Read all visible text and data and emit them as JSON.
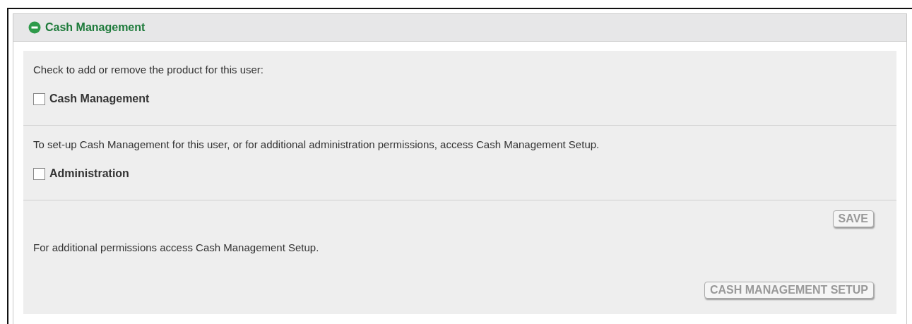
{
  "panel": {
    "title": "Cash Management",
    "expanded": true
  },
  "sections": [
    {
      "kind": "checkbox",
      "text": "Check to add or remove the product for this user:",
      "checkbox": {
        "label": "Cash Management",
        "checked": false
      }
    },
    {
      "kind": "checkbox",
      "text": "To set-up Cash Management for this user, or for additional administration permissions, access Cash Management Setup.",
      "checkbox": {
        "label": "Administration",
        "checked": false
      }
    },
    {
      "kind": "actions",
      "save_button": {
        "label": "SAVE",
        "disabled": true
      },
      "text": "For additional permissions access Cash Management Setup.",
      "setup_button": {
        "label": "CASH MANAGEMENT SETUP",
        "disabled": true
      }
    }
  ]
}
